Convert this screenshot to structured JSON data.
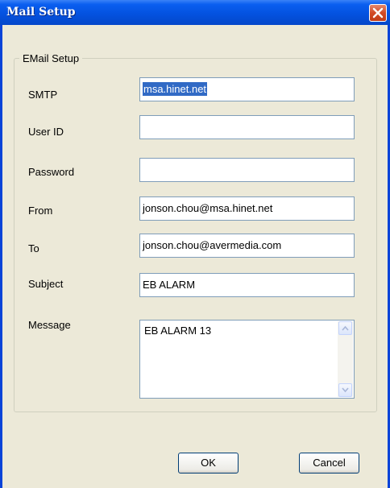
{
  "window": {
    "title": "Mail Setup"
  },
  "group": {
    "legend": "EMail Setup"
  },
  "fields": {
    "smtp": {
      "label": "SMTP",
      "value": "msa.hinet.net"
    },
    "user_id": {
      "label": "User ID",
      "value": ""
    },
    "password": {
      "label": "Password",
      "value": ""
    },
    "from": {
      "label": "From",
      "value": "jonson.chou@msa.hinet.net"
    },
    "to": {
      "label": "To",
      "value": "jonson.chou@avermedia.com"
    },
    "subject": {
      "label": "Subject",
      "value": "EB ALARM"
    },
    "message": {
      "label": "Message",
      "value": "EB ALARM 13"
    }
  },
  "buttons": {
    "ok": "OK",
    "cancel": "Cancel"
  },
  "icons": {
    "close": "close-icon",
    "scroll_up": "arrow-up-icon",
    "scroll_down": "arrow-down-icon"
  }
}
